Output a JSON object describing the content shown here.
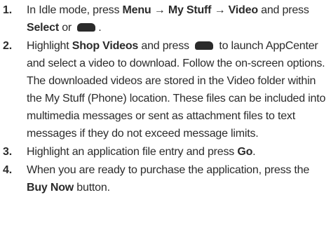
{
  "steps": [
    {
      "number": "1.",
      "parts": {
        "t1": "In Idle mode, press ",
        "b1": "Menu",
        "t2": " → ",
        "b2": "My Stuff",
        "t3": " → ",
        "b3": "Video",
        "t4": " and press ",
        "b4": "Select",
        "t5": " or ",
        "t6": "."
      }
    },
    {
      "number": "2.",
      "parts": {
        "t1": "Highlight ",
        "b1": "Shop Videos",
        "t2": " and press ",
        "t3": " to launch AppCenter and select a video to download. Follow the on-screen options. The downloaded videos are stored in the Video folder within the My Stuff (Phone) location. These files can be included into multimedia messages or sent as attachment files to text messages if they do not exceed message limits."
      }
    },
    {
      "number": "3.",
      "parts": {
        "t1": "Highlight an application file entry and press ",
        "b1": "Go",
        "t2": "."
      }
    },
    {
      "number": "4.",
      "parts": {
        "t1": "When you are ready to purchase the application, press the ",
        "b1": "Buy Now",
        "t2": " button."
      }
    }
  ],
  "icons": {
    "key": "center-select-key-icon"
  }
}
